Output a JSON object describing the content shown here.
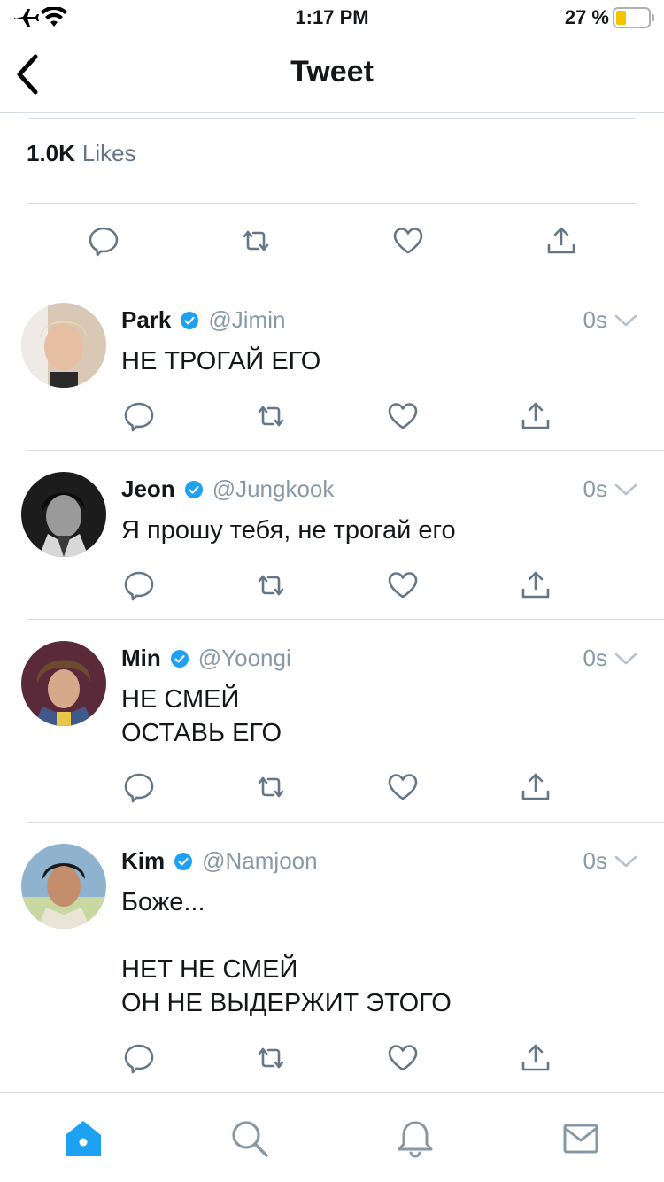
{
  "status_bar": {
    "time": "1:17 PM",
    "battery": "27 %"
  },
  "nav": {
    "title": "Tweet"
  },
  "stats": {
    "likes_count": "1.0K",
    "likes_label": "Likes"
  },
  "replies": [
    {
      "name": "Park",
      "handle": "@Jimin",
      "time": "0s",
      "lines": [
        "НЕ ТРОГАЙ ЕГО"
      ],
      "avatar_color": "#d9c8b6"
    },
    {
      "name": "Jeon",
      "handle": "@Jungkook",
      "time": "0s",
      "lines": [
        "Я прошу тебя, не трогай его"
      ],
      "avatar_color": "#2b2b2b"
    },
    {
      "name": "Min",
      "handle": "@Yoongi",
      "time": "0s",
      "lines": [
        "НЕ СМЕЙ",
        "ОСТАВЬ ЕГО"
      ],
      "avatar_color": "#4a3a44"
    },
    {
      "name": "Kim",
      "handle": "@Namjoon",
      "time": "0s",
      "lines": [
        "Боже...",
        "",
        "НЕТ НЕ СМЕЙ",
        "ОН НЕ ВЫДЕРЖИТ ЭТОГО"
      ],
      "avatar_color": "#7aa3c4"
    }
  ],
  "colors": {
    "accent": "#1da1f2",
    "icon_gray": "#657786",
    "divider": "#d8dde1",
    "battery_low": "#f5c400"
  },
  "icons": [
    "airplane-icon",
    "wifi-icon",
    "battery-icon",
    "back-icon",
    "reply-icon",
    "retweet-icon",
    "like-icon",
    "share-icon",
    "verified-icon",
    "chevron-down-icon",
    "home-icon",
    "search-icon",
    "notifications-icon",
    "messages-icon"
  ]
}
